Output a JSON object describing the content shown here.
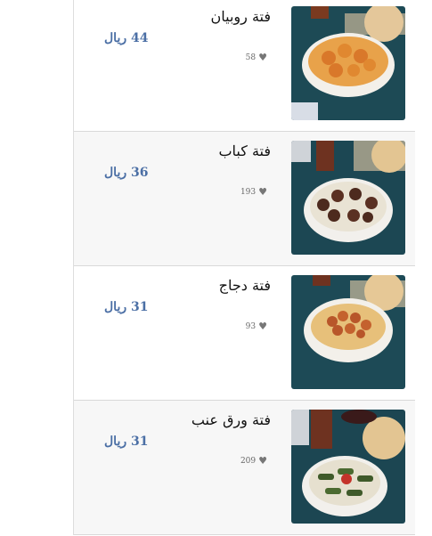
{
  "colors": {
    "price": "#4b6fa5",
    "name": "#111111",
    "likes": "#666666",
    "row_alt": "#f7f7f7"
  },
  "items": [
    {
      "name": "فتة روبيان",
      "price": "44 ريال",
      "likes": "58",
      "heart_icon": "heart-icon",
      "image": "shrimp-fatteh-bowl"
    },
    {
      "name": "فتة كباب",
      "price": "36 ريال",
      "likes": "193",
      "heart_icon": "heart-icon",
      "image": "kebab-fatteh-bowl"
    },
    {
      "name": "فتة دجاج",
      "price": "31 ريال",
      "likes": "93",
      "heart_icon": "heart-icon",
      "image": "chicken-fatteh-bowl"
    },
    {
      "name": "فتة ورق عنب",
      "price": "31 ريال",
      "likes": "209",
      "heart_icon": "heart-icon",
      "image": "grape-leaves-fatteh-bowl"
    }
  ]
}
